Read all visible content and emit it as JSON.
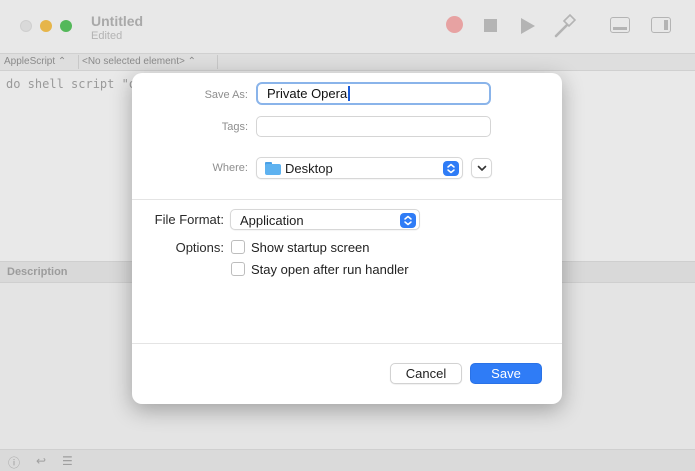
{
  "window": {
    "title": "Untitled",
    "subtitle": "Edited",
    "navbar": {
      "language": "AppleScript",
      "element": "<No selected element>"
    },
    "code_line": "do shell script \"o",
    "description_label": "Description"
  },
  "sheet": {
    "save_as_label": "Save As:",
    "save_as_value": "Private Opera",
    "tags_label": "Tags:",
    "where_label": "Where:",
    "where_value": "Desktop",
    "file_format_label": "File Format:",
    "file_format_value": "Application",
    "options_label": "Options:",
    "options": [
      {
        "label": "Show startup screen",
        "checked": false
      },
      {
        "label": "Stay open after run handler",
        "checked": false
      }
    ],
    "cancel_label": "Cancel",
    "save_label": "Save"
  },
  "colors": {
    "accent": "#2f7cf6",
    "focus_ring": "#8ab4ea"
  },
  "icons": {
    "where": "folder-icon",
    "stepper": "up-down-chevron-icon",
    "expand": "chevron-down-icon"
  }
}
